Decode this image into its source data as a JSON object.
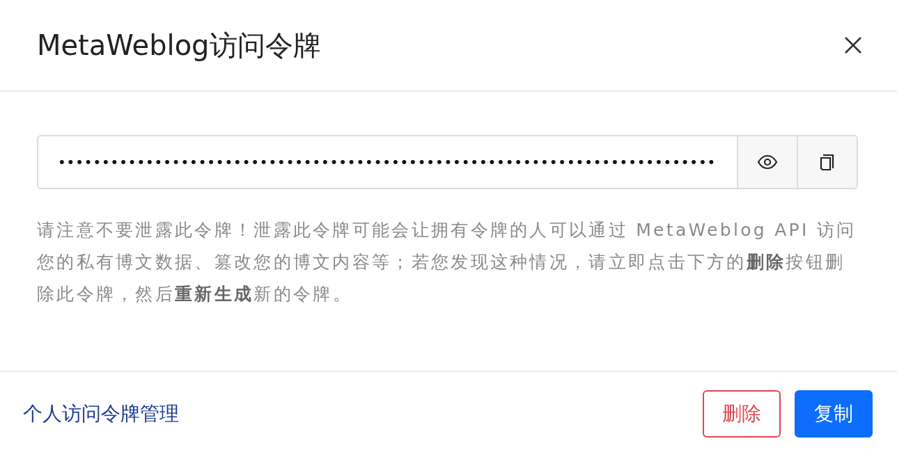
{
  "dialog": {
    "title": "MetaWeblog访问令牌",
    "token_field": {
      "value": "•••••••••••••••••••••••••••••••••••••••••••••••••••••••••••••••••••••••••••"
    },
    "warning": "请注意不要泄露此令牌！泄露此令牌可能会让拥有令牌的人可以通过 MetaWeblog API 访问您的私有博文数据、篡改您的博文内容等；若您发现这种情况，请立即点击下方的**删除**按钮删除此令牌，然后**重新生成**新的令牌。",
    "footer_link": "个人访问令牌管理",
    "buttons": [
      {
        "label": "删除",
        "kind": "danger"
      },
      {
        "label": "复制",
        "kind": "primary"
      }
    ]
  }
}
